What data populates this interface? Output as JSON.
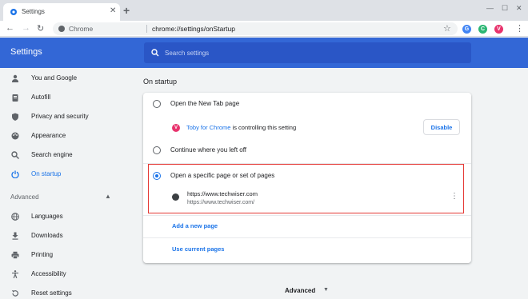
{
  "tab": {
    "title": "Settings",
    "close": "✕"
  },
  "newtab": "+",
  "window": {
    "minimize": "—",
    "maximize": "☐",
    "close": "✕"
  },
  "toolbar": {
    "back": "←",
    "forward": "→",
    "reload": "↻",
    "site_label": "Chrome",
    "url": "chrome://settings/onStartup",
    "extensions": [
      {
        "name": "grammarly",
        "glyph": "G",
        "color": "#4285f4"
      },
      {
        "name": "extension-c",
        "glyph": "C",
        "color": "#2bb673"
      },
      {
        "name": "toby",
        "glyph": "V",
        "color": "#e8336d"
      }
    ]
  },
  "header": {
    "title": "Settings",
    "search_placeholder": "Search settings"
  },
  "sidebar": {
    "items": [
      {
        "label": "You and Google",
        "icon": "person-icon"
      },
      {
        "label": "Autofill",
        "icon": "clipboard-icon"
      },
      {
        "label": "Privacy and security",
        "icon": "shield-icon"
      },
      {
        "label": "Appearance",
        "icon": "palette-icon"
      },
      {
        "label": "Search engine",
        "icon": "search-icon"
      },
      {
        "label": "On startup",
        "icon": "power-icon",
        "active": true
      }
    ],
    "advanced_label": "Advanced",
    "advanced_items": [
      {
        "label": "Languages",
        "icon": "globe-icon"
      },
      {
        "label": "Downloads",
        "icon": "download-icon"
      },
      {
        "label": "Printing",
        "icon": "printer-icon"
      },
      {
        "label": "Accessibility",
        "icon": "accessibility-icon"
      },
      {
        "label": "Reset settings",
        "icon": "reset-icon"
      }
    ]
  },
  "main": {
    "section_title": "On startup",
    "options": [
      {
        "label": "Open the New Tab page",
        "selected": false
      },
      {
        "label": "Continue where you left off",
        "selected": false
      },
      {
        "label": "Open a specific page or set of pages",
        "selected": true
      }
    ],
    "extension_notice": {
      "name": "Toby for Chrome",
      "suffix": " is controlling this setting",
      "button": "Disable"
    },
    "page": {
      "title": "https://www.techwiser.com",
      "url": "https://www.techwiser.com/"
    },
    "add_page": "Add a new page",
    "use_current": "Use current pages",
    "advanced_footer": "Advanced"
  },
  "colors": {
    "accent": "#1a73e8",
    "header": "#3367d6",
    "highlight": "#e53935"
  }
}
